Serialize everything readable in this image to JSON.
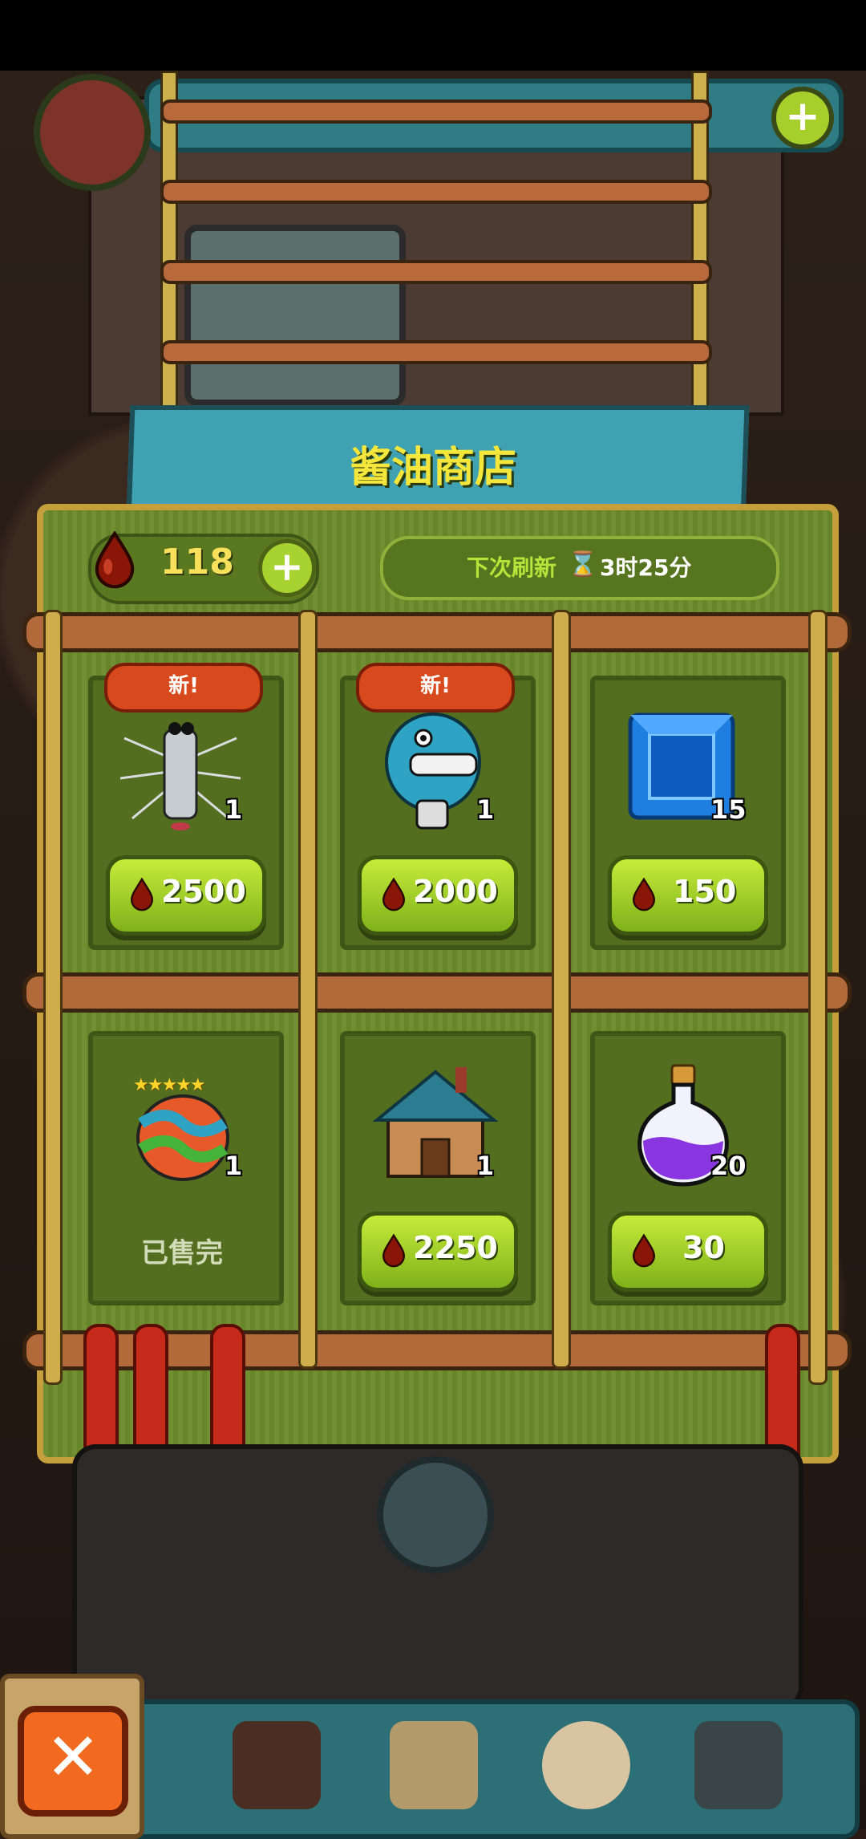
{
  "shop": {
    "title": "酱油商店",
    "currency": {
      "icon": "soy-drop-icon",
      "amount": "118",
      "plus": "+"
    },
    "refresh": {
      "label": "下次刷新",
      "icon": "hourglass-icon",
      "time": "3时25分"
    }
  },
  "items": [
    {
      "name": "spiky-white-monster",
      "badge": "新!",
      "qty": "1",
      "price": "2500"
    },
    {
      "name": "blue-fish-monster",
      "badge": "新!",
      "qty": "1",
      "price": "2000"
    },
    {
      "name": "blue-gem",
      "badge": "",
      "qty": "15",
      "price": "150"
    },
    {
      "name": "five-star-egg",
      "badge": "",
      "qty": "1",
      "status": "已售完",
      "stars": "★★★★★"
    },
    {
      "name": "blue-roof-house",
      "badge": "",
      "qty": "1",
      "price": "2250"
    },
    {
      "name": "purple-potion",
      "badge": "",
      "qty": "20",
      "price": "30"
    }
  ],
  "hud": {
    "plus": "+"
  },
  "close": {
    "label": "✕"
  },
  "colors": {
    "accent_green": "#a6cf2b",
    "currency_yellow": "#f8e05a",
    "badge_red": "#d84a1d",
    "close_orange": "#f26a1f"
  }
}
